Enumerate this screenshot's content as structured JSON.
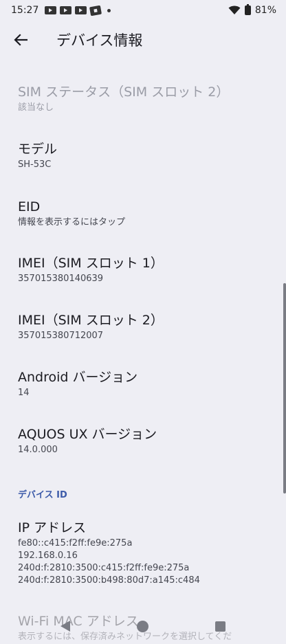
{
  "status_bar": {
    "time": "15:27",
    "battery": "81%",
    "icons": [
      "youtube-icon",
      "youtube-icon",
      "youtube-icon",
      "news-icon",
      "dot-icon",
      "wifi-icon",
      "battery-icon"
    ]
  },
  "app_bar": {
    "title": "デバイス情報",
    "back_icon": "arrow-left-icon"
  },
  "items": [
    {
      "title": "SIM ステータス（SIM スロット 2）",
      "subtitle": "該当なし",
      "disabled": true
    },
    {
      "title": "モデル",
      "subtitle": "SH-53C"
    },
    {
      "title": "EID",
      "subtitle": "情報を表示するにはタップ"
    },
    {
      "title": "IMEI（SIM スロット 1）",
      "subtitle": "357015380140639"
    },
    {
      "title": "IMEI（SIM スロット 2）",
      "subtitle": "357015380712007"
    },
    {
      "title": "Android バージョン",
      "subtitle": "14"
    },
    {
      "title": "AQUOS UX バージョン",
      "subtitle": "14.0.000"
    }
  ],
  "section_header": "デバイス ID",
  "ip_address": {
    "title": "IP アドレス",
    "lines": [
      "fe80::c415:f2ff:fe9e:275a",
      "192.168.0.16",
      "240d:f:2810:3500:c415:f2ff:fe9e:275a",
      "240d:f:2810:3500:b498:80d7:a145:c484"
    ]
  },
  "wifi_mac": {
    "title": "Wi-Fi MAC アドレス",
    "subtitle": "表示するには、保存済みネットワークを選択してくだ"
  },
  "nav": {
    "back_icon": "nav-back-icon",
    "home_icon": "nav-home-icon",
    "recents_icon": "nav-recents-icon"
  }
}
